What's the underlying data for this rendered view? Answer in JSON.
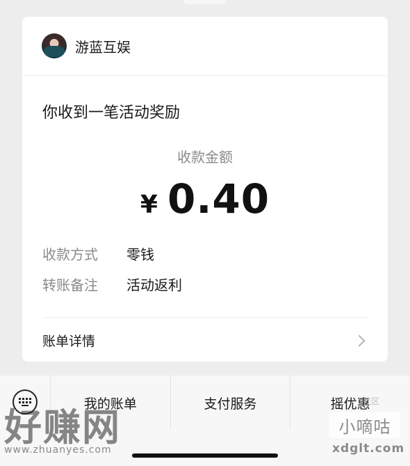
{
  "merchant": {
    "name": "游蓝互娱"
  },
  "notice": "你收到一笔活动奖励",
  "amount": {
    "label": "收款金额",
    "currency": "¥",
    "value": "0.40"
  },
  "details": [
    {
      "key": "收款方式",
      "value": "零钱"
    },
    {
      "key": "转账备注",
      "value": "活动返利"
    }
  ],
  "bill_details_label": "账单详情",
  "bottom_menu": [
    "我的账单",
    "支付服务",
    "摇优惠"
  ],
  "watermarks": {
    "left_text": "好赚网",
    "left_url": "www.zhuanyes.com",
    "right_text": "小嘀咕",
    "right_url": "xdglt.com",
    "right_top": "社区"
  }
}
